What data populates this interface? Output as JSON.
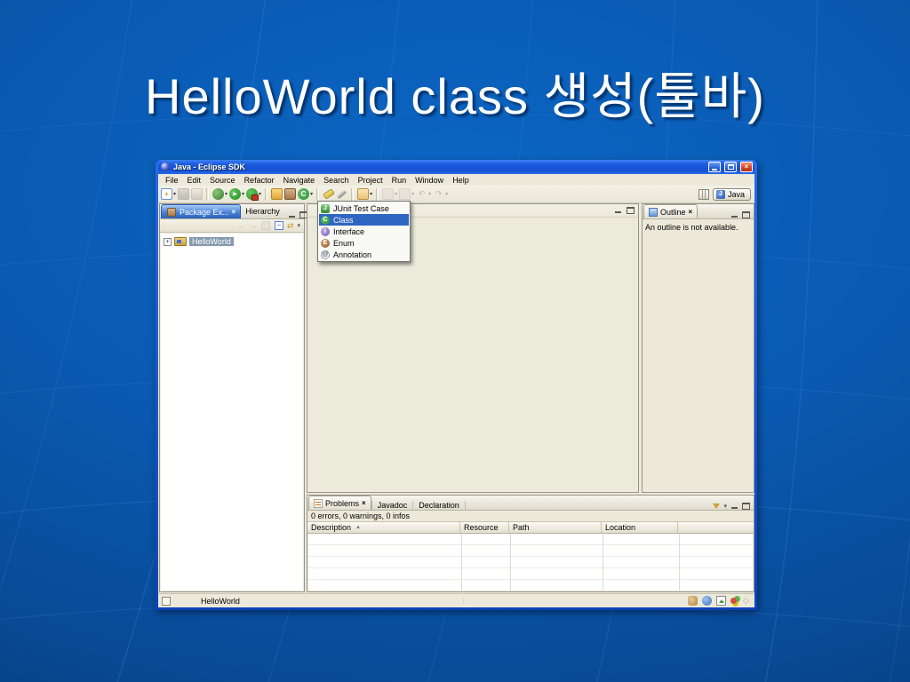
{
  "slide": {
    "title": "HelloWorld class 생성(툴바)"
  },
  "colors": {
    "slide_background": "#0a59b0",
    "titlebar_blue": "#1c5be0",
    "chrome_beige": "#ece9da",
    "selection_blue": "#2f66c2",
    "tree_selection": "#8598ad",
    "close_red": "#da4628"
  },
  "window": {
    "title": "Java - Eclipse SDK",
    "menus": [
      "File",
      "Edit",
      "Source",
      "Refactor",
      "Navigate",
      "Search",
      "Project",
      "Run",
      "Window",
      "Help"
    ],
    "perspective_label": "Java"
  },
  "new_menu": {
    "items": [
      {
        "label": "JUnit Test Case",
        "selected": false
      },
      {
        "label": "Class",
        "selected": true
      },
      {
        "label": "Interface",
        "selected": false
      },
      {
        "label": "Enum",
        "selected": false
      },
      {
        "label": "Annotation",
        "selected": false
      }
    ]
  },
  "package_explorer": {
    "active_tab": "Package Ex...",
    "inactive_tab": "Hierarchy",
    "tree": [
      {
        "label": "HelloWorld"
      }
    ]
  },
  "outline": {
    "tab": "Outline",
    "message": "An outline is not available."
  },
  "problems": {
    "active_tab": "Problems",
    "tabs": [
      "Javadoc",
      "Declaration"
    ],
    "summary": "0 errors, 0 warnings, 0 infos",
    "columns": [
      "Description",
      "Resource",
      "Path",
      "Location"
    ]
  },
  "statusbar": {
    "label": "HelloWorld"
  },
  "glyphs": {
    "close": "×",
    "caret": "▾",
    "chevron": "▾",
    "sort_asc": "▲",
    "plus": "+",
    "minus": "−",
    "back": "←",
    "fwd": "→",
    "undo": "↶",
    "redo": "↷",
    "play": "▶",
    "at": "@",
    "link": "⇄",
    "dots": "⋮",
    "diamond": "◇",
    "junit_letter": "J",
    "class_letter": "C",
    "interface_letter": "I",
    "enum_letter": "E",
    "java_letter": "J"
  }
}
